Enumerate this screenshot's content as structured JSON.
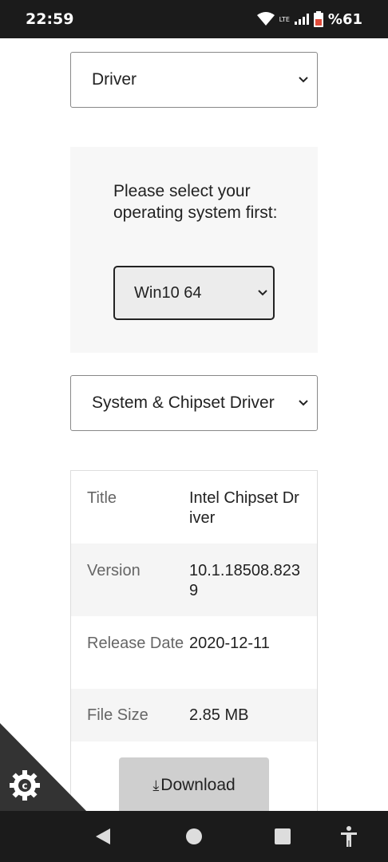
{
  "status": {
    "time": "22:59",
    "network": "LTE",
    "battery": "%61"
  },
  "type_select": {
    "value": "Driver"
  },
  "os_panel": {
    "label": "Please select your operating system first:",
    "os_value": "Win10 64"
  },
  "category_select": {
    "value": "System & Chipset Driver"
  },
  "details": {
    "rows": [
      {
        "key": "Title",
        "value": "Intel Chipset Driver"
      },
      {
        "key": "Version",
        "value": "10.1.18508.8239"
      },
      {
        "key": "Release Date",
        "value": "2020-12-11"
      },
      {
        "key": "File Size",
        "value": "2.85 MB"
      }
    ],
    "download_label": "Download"
  },
  "icons": {
    "cookie": "cookie-settings-icon",
    "back": "back-icon",
    "home": "home-icon",
    "recents": "recents-icon",
    "accessibility": "accessibility-icon"
  }
}
